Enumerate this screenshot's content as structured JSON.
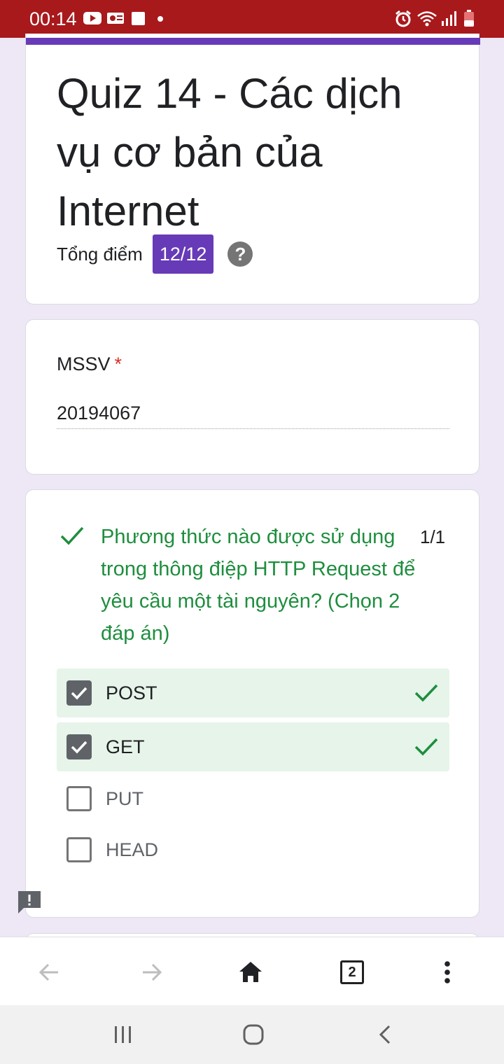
{
  "status_bar": {
    "time": "00:14",
    "left_icons": [
      "youtube-icon",
      "outlook-icon",
      "square-notification-icon",
      "dot-icon"
    ],
    "right_icons": [
      "alarm-icon",
      "wifi-icon",
      "signal-icon",
      "battery-low-icon"
    ],
    "background": "#a8191c"
  },
  "form": {
    "title": "Quiz 14 - Các dịch vụ cơ bản của Internet",
    "score_label": "Tổng điểm",
    "score_value": "12/12",
    "accent_color": "#673ab7"
  },
  "mssv": {
    "label": "MSSV",
    "required_mark": "*",
    "value": "20194067"
  },
  "question": {
    "text": "Phương thức nào được sử dụng trong thông điệp HTTP Request để yêu cầu một tài nguyên? (Chọn 2 đáp án)",
    "points": "1/1",
    "status_color": "#1e8e3e",
    "options": [
      {
        "label": "POST",
        "checked": true,
        "correct": true
      },
      {
        "label": "GET",
        "checked": true,
        "correct": true
      },
      {
        "label": "PUT",
        "checked": false,
        "correct": false
      },
      {
        "label": "HEAD",
        "checked": false,
        "correct": false
      }
    ]
  },
  "toolbar": {
    "tab_count": "2",
    "icons": [
      "back-arrow-icon",
      "forward-arrow-icon",
      "home-icon",
      "tabs-icon",
      "more-vert-icon"
    ]
  },
  "system_nav": {
    "icons": [
      "recents-icon",
      "home-circle-icon",
      "back-chevron-icon"
    ]
  }
}
